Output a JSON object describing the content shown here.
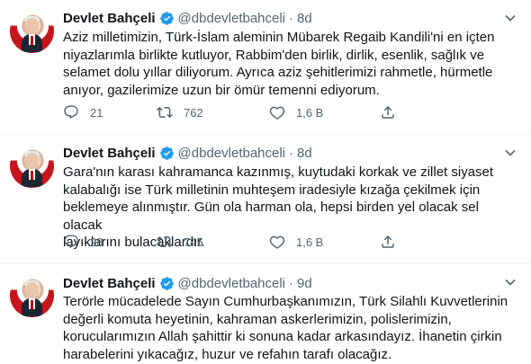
{
  "author": {
    "name": "Devlet Bahçeli",
    "handle": "@dbdevletbahceli",
    "separator": "·"
  },
  "colors": {
    "text": "#0f1419",
    "secondary": "#536471",
    "verified": "#1d9bf0",
    "border": "#eff3f4"
  },
  "icons": {
    "verified": "verified-badge-icon",
    "more": "more-icon",
    "reply": "reply-icon",
    "retweet": "retweet-icon",
    "like": "heart-icon",
    "share": "share-icon"
  },
  "tweets": [
    {
      "time": "8d",
      "text": "Aziz milletimizin, Türk-İslam aleminin Mübarek Regaib Kandili'ni en içten\nniyazlarımla birlikte kutluyor, Rabbim'den birlik, dirlik, esenlik, sağlık ve\nselamet dolu yıllar diliyorum. Ayrıca aziz şehitlerimizi rahmetle, hürmetle\nanıyor, gazilerimize uzun bir ömür temenni ediyorum.",
      "replies": "21",
      "retweets": "762",
      "likes": "1,6 B"
    },
    {
      "time": "8d",
      "text": "Gara'nın karası kahramanca kazınmış, kuytudaki korkak ve zillet siyaset\nkalabalığı ise Türk milletinin muhteşem iradesiyle kızağa çekilmek için\nbeklemeye alınmıştır. Gün ola harman ola, hepsi birden yel olacak sel olacak\nlayıklarını bulacaklardır.",
      "replies": "28",
      "retweets": "745",
      "likes": "1,6 B"
    },
    {
      "time": "9d",
      "text": "Terörle mücadelede Sayın Cumhurbaşkanımızın, Türk Silahlı Kuvvetlerinin\ndeğerli komuta heyetinin, kahraman askerlerimizin, polislerimizin,\nkorucularımızın Allah şahittir ki sonuna kadar arkasındayız. İhanetin çirkin\nharabelerini yıkacağız, huzur ve refahın tarafı olacağız."
    }
  ]
}
